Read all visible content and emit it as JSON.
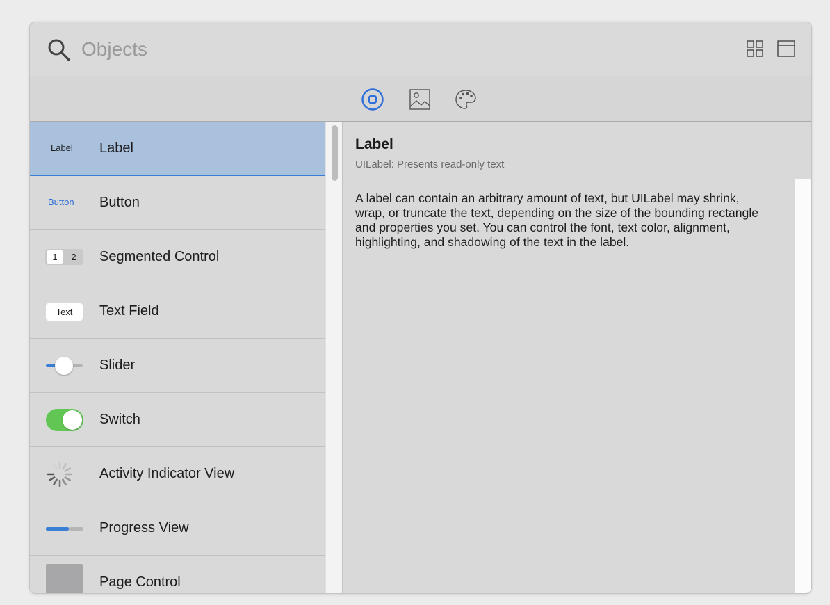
{
  "search": {
    "placeholder": "Objects",
    "value": ""
  },
  "header_icons": [
    "grid-view-icon",
    "panel-view-icon"
  ],
  "tabs": [
    {
      "icon": "objects-tab-icon",
      "selected": true
    },
    {
      "icon": "media-tab-icon",
      "selected": false
    },
    {
      "icon": "colors-tab-icon",
      "selected": false
    }
  ],
  "list": {
    "items": [
      {
        "label": "Label",
        "preview": "Label",
        "selected": true
      },
      {
        "label": "Button",
        "preview": "Button"
      },
      {
        "label": "Segmented Control",
        "preview": [
          "1",
          "2"
        ]
      },
      {
        "label": "Text Field",
        "preview": "Text"
      },
      {
        "label": "Slider",
        "preview_icon": "slider-preview-icon"
      },
      {
        "label": "Switch",
        "preview_icon": "switch-preview-icon"
      },
      {
        "label": "Activity Indicator View",
        "preview_icon": "activity-indicator-icon"
      },
      {
        "label": "Progress View",
        "preview_icon": "progress-preview-icon"
      },
      {
        "label": "Page Control",
        "preview": "•••"
      }
    ]
  },
  "detail": {
    "title": "Label",
    "subtitle": "UILabel: Presents read-only text",
    "body": "A label can contain an arbitrary amount of text, but UILabel may shrink, wrap, or truncate the text, depending on the size of the bounding rectangle and properties you set. You can control the font, text color, alignment, highlighting, and shadowing of the text in the label."
  },
  "colors": {
    "accent": "#3a7fd6",
    "selection": "#a9c1dd",
    "switch_on": "#62c654",
    "background": "#d9d9d9"
  }
}
